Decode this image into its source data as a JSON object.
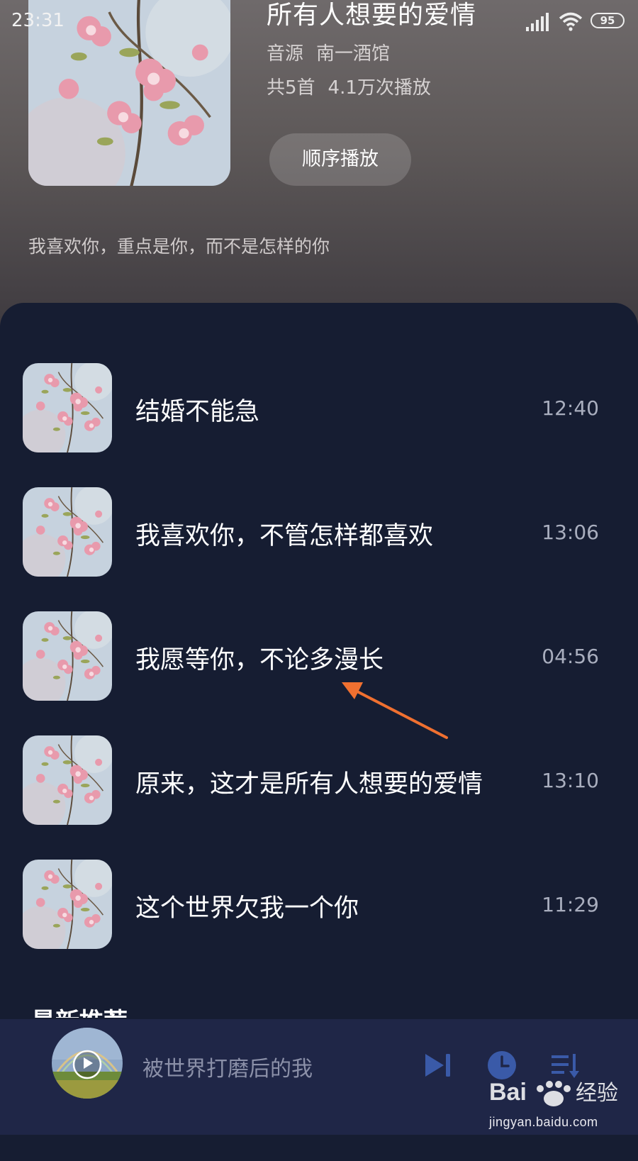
{
  "status_bar": {
    "time": "23:31",
    "battery": "95"
  },
  "album": {
    "title": "所有人想要的爱情",
    "source_label": "音源",
    "source_name": "南一酒馆",
    "track_count": "共5首",
    "play_count": "4.1万次播放",
    "play_order_label": "顺序播放",
    "description": "我喜欢你，重点是你，而不是怎样的你"
  },
  "tracks": [
    {
      "title": "结婚不能急",
      "duration": "12:40"
    },
    {
      "title": "我喜欢你，不管怎样都喜欢",
      "duration": "13:06"
    },
    {
      "title": "我愿等你，不论多漫长",
      "duration": "04:56"
    },
    {
      "title": "原来，这才是所有人想要的爱情",
      "duration": "13:10"
    },
    {
      "title": "这个世界欠我一个你",
      "duration": "11:29"
    }
  ],
  "next_section_title": "最新推荐",
  "player": {
    "now_playing": "被世界打磨后的我"
  },
  "watermark": {
    "brand": "Bai经验",
    "url": "jingyan.baidu.com"
  },
  "colors": {
    "accent_arrow": "#f07030",
    "sheet_bg": "#161d32",
    "player_bg": "#1f2647"
  }
}
